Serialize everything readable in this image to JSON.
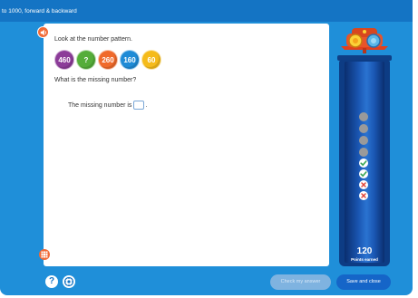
{
  "header": {
    "title": "to 1000, forward & backward"
  },
  "question": {
    "prompt": "Look at the number pattern.",
    "pattern": [
      {
        "value": "460",
        "color": "#8c3c99"
      },
      {
        "value": "?",
        "color": "#55ad3a"
      },
      {
        "value": "260",
        "color": "#f06a2b"
      },
      {
        "value": "160",
        "color": "#1f8bd6"
      },
      {
        "value": "60",
        "color": "#f5bb1a"
      }
    ],
    "text": "What is the missing number?",
    "answer_prefix": "The missing number is",
    "answer_value": "",
    "answer_suffix": "."
  },
  "progress": {
    "results": [
      "empty",
      "empty",
      "empty",
      "empty",
      "correct",
      "correct",
      "wrong",
      "wrong"
    ],
    "points_value": "120",
    "points_label": "Points earned"
  },
  "footer": {
    "check_label": "Check my answer",
    "save_label": "Save and close",
    "help_label": "?"
  },
  "icons": {
    "audio": "speaker-icon",
    "helper": "grid-icon",
    "settings": "settings-icon"
  },
  "colors": {
    "background": "#1f8fd9",
    "accent_orange": "#f26a36",
    "save_button": "#1565c8",
    "check_button_disabled": "#7fb3e0",
    "tube": "#0d3c84"
  }
}
